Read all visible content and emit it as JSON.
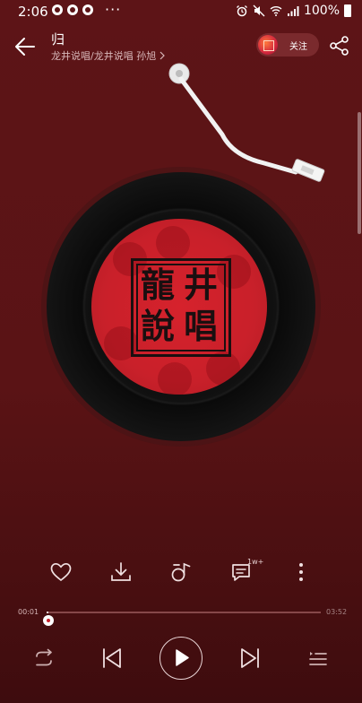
{
  "status_bar": {
    "time": "2:06",
    "more": "···",
    "battery": "100%"
  },
  "header": {
    "title": "归",
    "subtitle": "龙井说唱/龙井说唱 孙旭",
    "follow_label": "关注"
  },
  "disc": {
    "seal_chars": [
      "龍",
      "井",
      "說",
      "唱"
    ]
  },
  "actions": {
    "comment_count_badge": "1w+"
  },
  "progress": {
    "current_time": "00:01",
    "total_time": "03:52",
    "played_fraction": 0.005
  },
  "colors": {
    "background": "#5d1417",
    "label_red": "#d6222c"
  }
}
